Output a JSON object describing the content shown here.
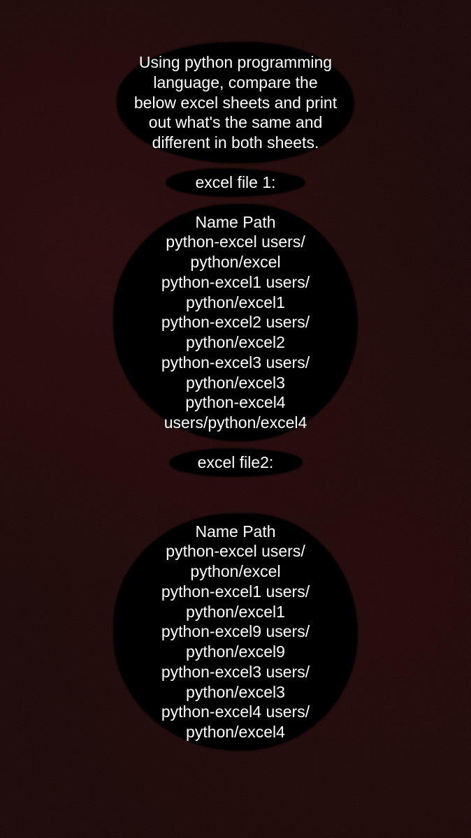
{
  "intro": "Using python programming language, compare the below excel sheets and print out what's the same and different in both sheets.",
  "file1_label": "excel file 1:",
  "file1_header": "Name Path",
  "file1_rows": [
    "python-excel users/",
    "python/excel",
    "python-excel1  users/",
    "python/excel1",
    "python-excel2  users/",
    "python/excel2",
    "python-excel3  users/",
    "python/excel3",
    "python-excel4",
    "users/python/excel4"
  ],
  "file2_label": "excel file2:",
  "file2_header": "Name Path",
  "file2_rows": [
    "python-excel users/",
    "python/excel",
    "python-excel1  users/",
    "python/excel1",
    "python-excel9  users/",
    "python/excel9",
    "python-excel3  users/",
    "python/excel3",
    "python-excel4  users/",
    "python/excel4"
  ]
}
